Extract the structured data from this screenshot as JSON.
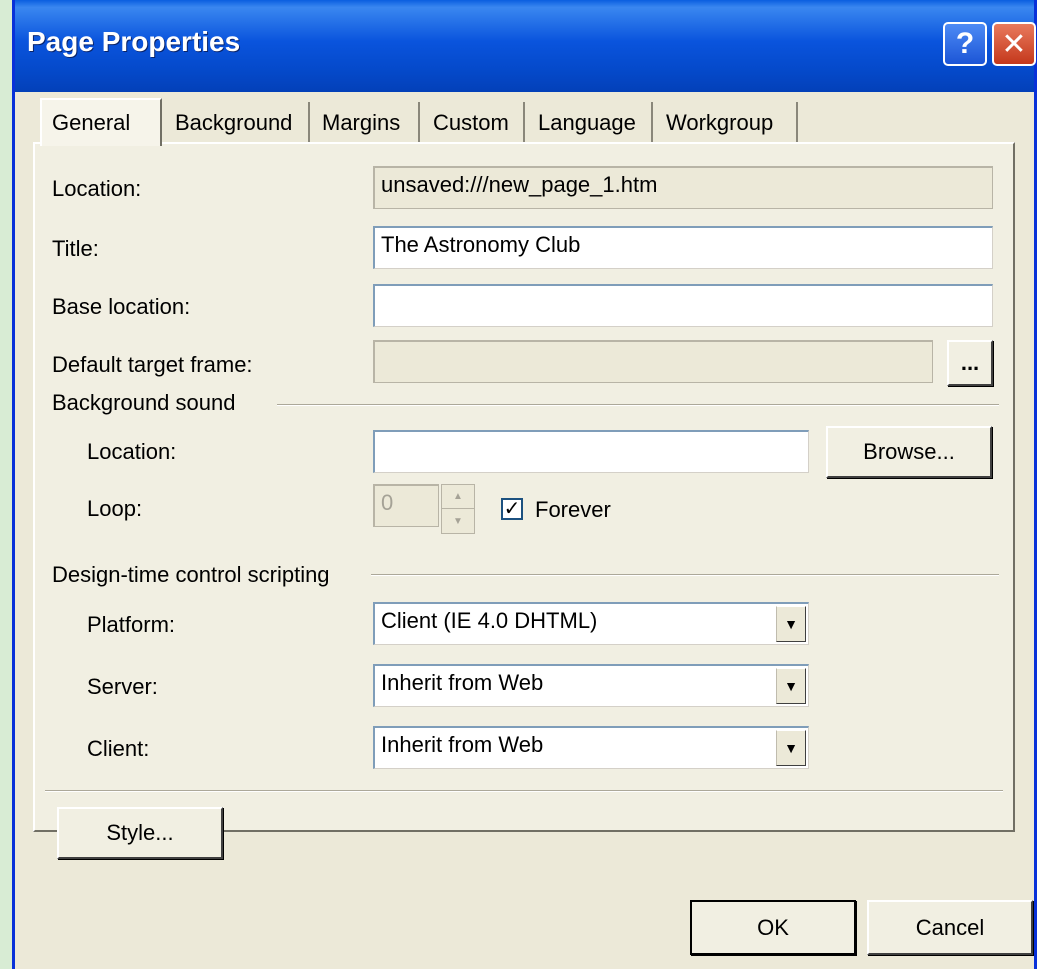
{
  "window": {
    "title": "Page Properties",
    "help_glyph": "?",
    "close_glyph": "✕"
  },
  "tabs": [
    {
      "label": "General",
      "active": true
    },
    {
      "label": "Background"
    },
    {
      "label": "Margins"
    },
    {
      "label": "Custom"
    },
    {
      "label": "Language"
    },
    {
      "label": "Workgroup"
    }
  ],
  "general": {
    "location_label": "Location:",
    "location_value": "unsaved:///new_page_1.htm",
    "title_label": "Title:",
    "title_value": "The Astronomy Club",
    "base_label": "Base location:",
    "base_value": "",
    "target_label": "Default target frame:",
    "target_value": "",
    "target_button": "..."
  },
  "sound": {
    "group_label": "Background sound",
    "location_label": "Location:",
    "location_value": "",
    "browse_label": "Browse...",
    "loop_label": "Loop:",
    "loop_value": "0",
    "forever_label": "Forever",
    "forever_checked": "✓"
  },
  "scripting": {
    "group_label": "Design-time control scripting",
    "platform_label": "Platform:",
    "platform_value": "Client (IE 4.0 DHTML)",
    "server_label": "Server:",
    "server_value": "Inherit from Web",
    "client_label": "Client:",
    "client_value": "Inherit from Web",
    "dropdown_glyph": "▼"
  },
  "buttons": {
    "style": "Style...",
    "ok": "OK",
    "cancel": "Cancel"
  },
  "colors": {
    "titlebar": "#0a54dd",
    "dialog_face": "#ece9d8",
    "close_button": "#c4381c"
  }
}
